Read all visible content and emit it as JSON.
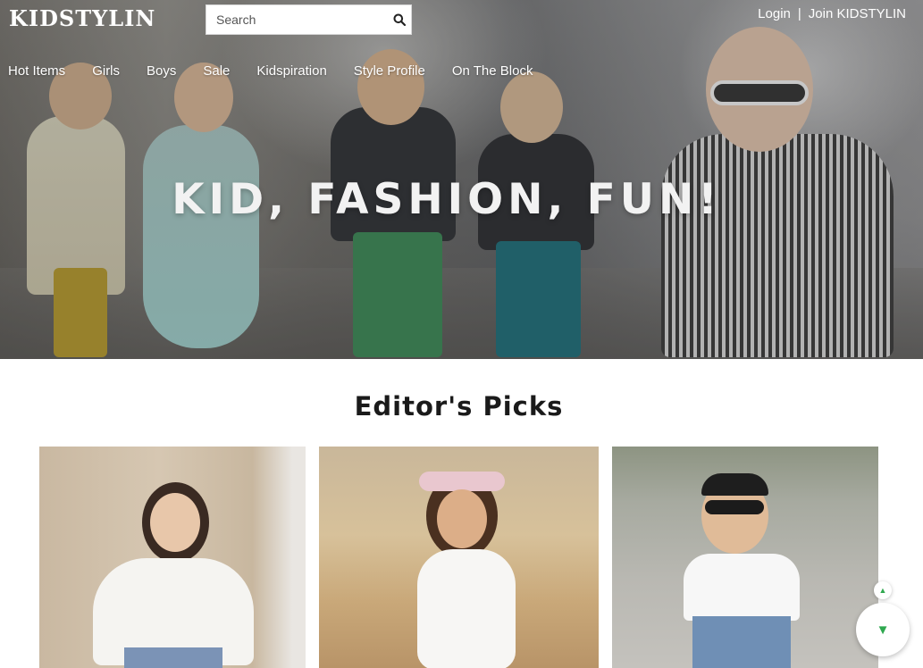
{
  "header": {
    "logo_text": "KIDSTYLIN",
    "search": {
      "placeholder": "Search",
      "value": ""
    },
    "auth": {
      "login_label": "Login",
      "separator": "|",
      "join_label": "Join KIDSTYLIN"
    }
  },
  "nav": {
    "items": [
      {
        "label": "Hot Items"
      },
      {
        "label": "Girls"
      },
      {
        "label": "Boys"
      },
      {
        "label": "Sale"
      },
      {
        "label": "Kidspiration"
      },
      {
        "label": "Style Profile"
      },
      {
        "label": "On The Block"
      }
    ]
  },
  "hero": {
    "tagline": "KID, FASHION, FUN!"
  },
  "picks": {
    "title": "Editor's Picks",
    "items": [
      {
        "icon": "girl-white-blouse-photo"
      },
      {
        "icon": "girl-flower-crown-photo"
      },
      {
        "icon": "boy-sunglasses-photo"
      }
    ]
  },
  "scroll": {
    "up_icon": "triangle-up-icon",
    "down_icon": "triangle-down-icon"
  },
  "colors": {
    "accent": "#2fa84f",
    "hero_text": "#ffffff",
    "title": "#1a1a1a"
  }
}
